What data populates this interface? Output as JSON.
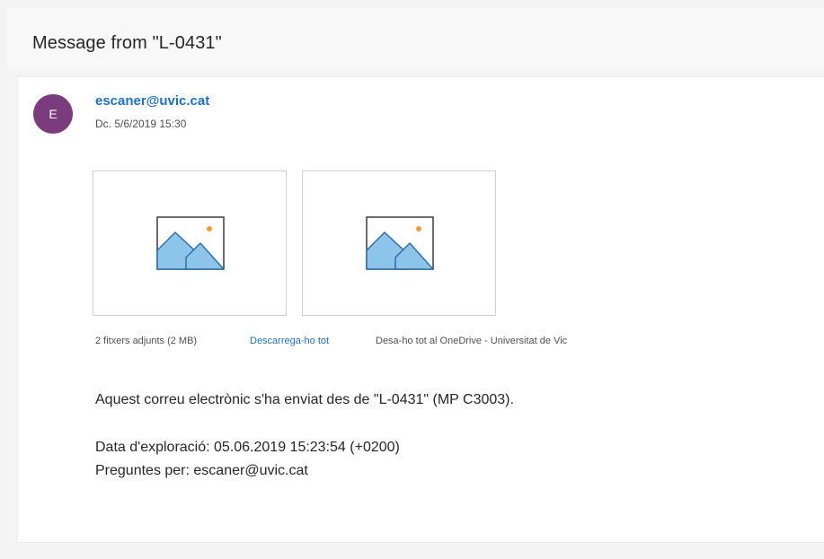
{
  "header": {
    "title": "Message from \"L-0431\""
  },
  "message": {
    "avatar_initial": "E",
    "sender": "escaner@uvic.cat",
    "date": "Dc. 5/6/2019 15:30",
    "attachments": {
      "count_label": "2 fitxers adjunts (2 MB)",
      "download_all_label": "Descarrega-ho tot",
      "save_onedrive_label": "Desa-ho tot al OneDrive - Universitat de Vic",
      "items": [
        {
          "icon": "image-icon"
        },
        {
          "icon": "image-icon"
        }
      ]
    },
    "body": {
      "line1": "Aquest correu electrònic s'ha enviat des de \"L-0431\" (MP C3003).",
      "line2": "Data d'exploració: 05.06.2019 15:23:54 (+0200)",
      "line3": "Preguntes per: escaner@uvic.cat"
    }
  },
  "colors": {
    "accent": "#1e70c2",
    "avatar": "#7b3c7d",
    "image_fill": "#8cc4ea",
    "image_stroke": "#2d6fa8",
    "sun": "#f39c3c"
  }
}
